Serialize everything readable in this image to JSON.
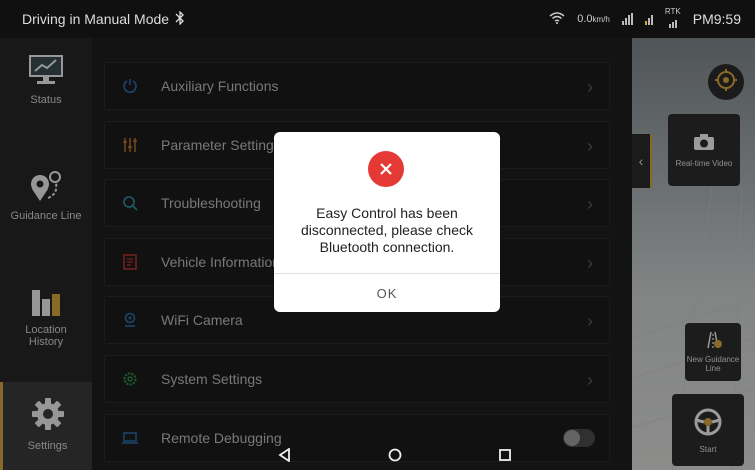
{
  "statusbar": {
    "mode_text": "Driving in Manual Mode",
    "speed_value": "0.0",
    "speed_unit": "km/h",
    "rtk_label": "RTK",
    "time": "PM9:59"
  },
  "sidebar": {
    "items": [
      {
        "label": "Status",
        "icon": "monitor-icon"
      },
      {
        "label": "Guidance Line",
        "icon": "route-pin-icon"
      },
      {
        "label": "Location History",
        "icon": "bar-chart-icon"
      },
      {
        "label": "Settings",
        "icon": "gear-icon"
      }
    ]
  },
  "list": {
    "items": [
      {
        "label": "Auxiliary Functions",
        "icon": "power-icon"
      },
      {
        "label": "Parameter Settings",
        "icon": "sliders-icon"
      },
      {
        "label": "Troubleshooting",
        "icon": "search-icon"
      },
      {
        "label": "Vehicle Information",
        "icon": "document-icon"
      },
      {
        "label": "WiFi Camera",
        "icon": "location-icon"
      },
      {
        "label": "System Settings",
        "icon": "settings-icon"
      },
      {
        "label": "Remote Debugging",
        "icon": "laptop-icon"
      }
    ]
  },
  "rightpanel": {
    "realtime_video": "Real-time Video",
    "new_guidance": "New Guidance Line",
    "start": "Start"
  },
  "dialog": {
    "message": "Easy Control has been disconnected, please check Bluetooth connection.",
    "ok": "OK"
  },
  "colors": {
    "accent": "#d0a43a",
    "error": "#e53935",
    "green": "#3aa655"
  }
}
